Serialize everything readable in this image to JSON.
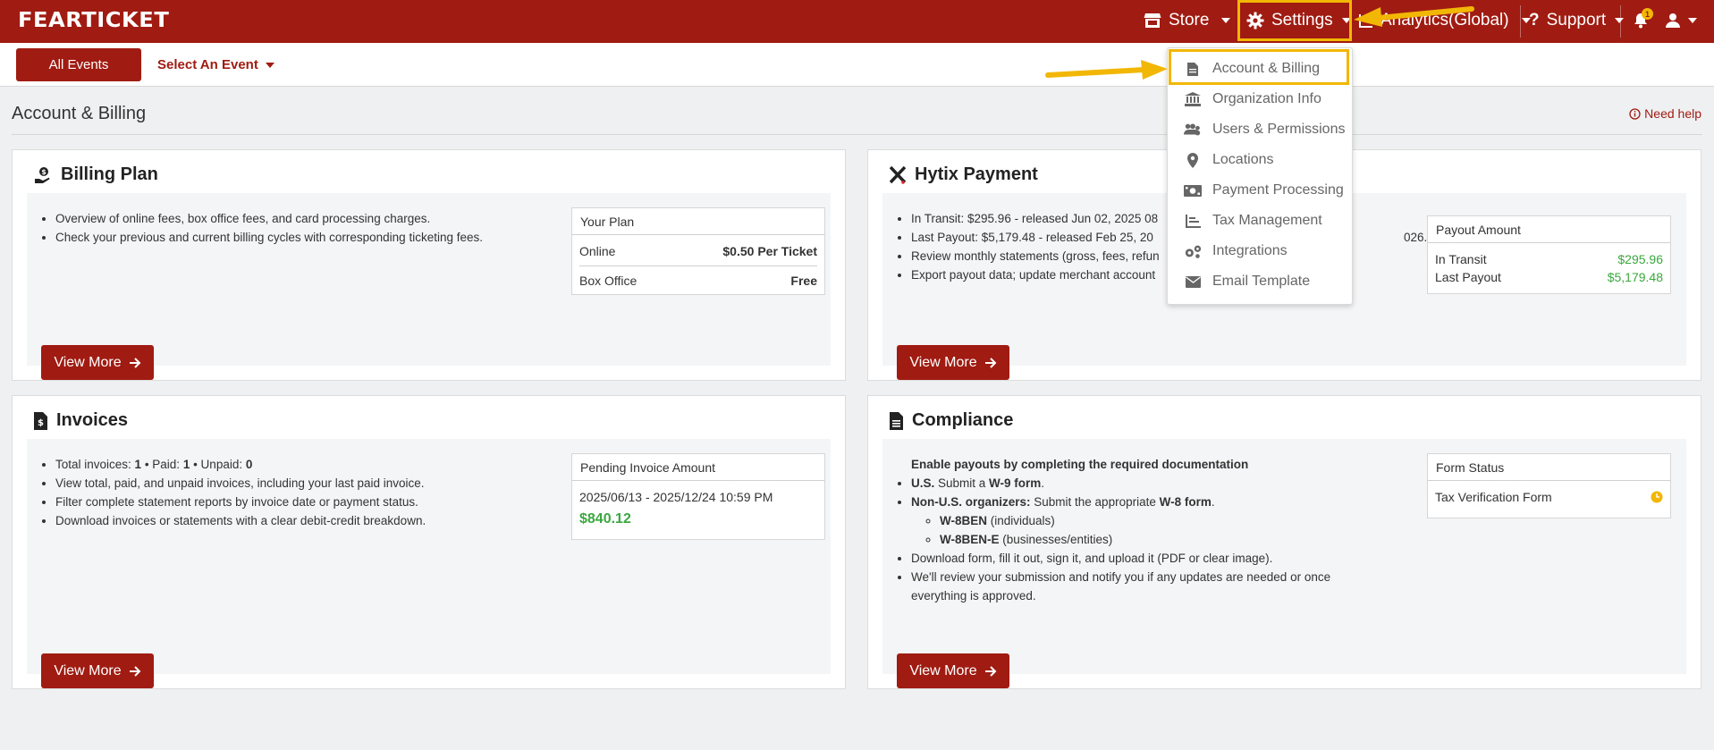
{
  "brand": {
    "logo": "FEARTICKET"
  },
  "topnav": {
    "store": "Store",
    "settings": "Settings",
    "analytics": "Analytics(Global)",
    "support": "Support",
    "notif_count": "1"
  },
  "subnav": {
    "all_events": "All Events",
    "select_event": "Select An Event"
  },
  "page": {
    "title": "Account & Billing",
    "help": "Need help"
  },
  "settings_menu": {
    "items": [
      {
        "label": "Account & Billing",
        "icon": "file-icon"
      },
      {
        "label": "Organization Info",
        "icon": "bank-icon"
      },
      {
        "label": "Users & Permissions",
        "icon": "users-icon"
      },
      {
        "label": "Locations",
        "icon": "map-pin-icon"
      },
      {
        "label": "Payment Processing",
        "icon": "money-icon"
      },
      {
        "label": "Tax Management",
        "icon": "chart-icon"
      },
      {
        "label": "Integrations",
        "icon": "cogs-icon"
      },
      {
        "label": "Email Template",
        "icon": "envelope-icon"
      }
    ]
  },
  "billing": {
    "title": "Billing Plan",
    "bullets": [
      "Overview of online fees, box office fees, and card processing charges.",
      "Check your previous and current billing cycles with corresponding ticketing fees."
    ],
    "box_title": "Your Plan",
    "online_label": "Online",
    "online_value": "$0.50 Per Ticket",
    "box_office_label": "Box Office",
    "box_office_value": "Free",
    "view_more": "View More"
  },
  "hytix": {
    "title": "Hytix Payment",
    "bullets": [
      "In Transit: $295.96 - released Jun 02, 2025 08",
      "Last Payout: $5,179.48 - released Feb 25, 20",
      "Review monthly statements (gross, fees, refun",
      "Export payout data; update merchant account"
    ],
    "bullet_tail": "026.",
    "box_title": "Payout Amount",
    "in_transit_label": "In Transit",
    "in_transit_value": "$295.96",
    "last_payout_label": "Last Payout",
    "last_payout_value": "$5,179.48",
    "view_more": "View More"
  },
  "invoices": {
    "title": "Invoices",
    "b1_a": "Total invoices: ",
    "b1_total": "1",
    "b1_b": " • Paid: ",
    "b1_paid": "1",
    "b1_c": " • Unpaid: ",
    "b1_unpaid": "0",
    "bullets": [
      "View total, paid, and unpaid invoices, including your last paid invoice.",
      "Filter complete statement reports by invoice date or payment status.",
      "Download invoices or statements with a clear debit-credit breakdown."
    ],
    "box_title": "Pending Invoice Amount",
    "date_range": "2025/06/13 - 2025/12/24 10:59 PM",
    "amount": "$840.12",
    "view_more": "View More"
  },
  "compliance": {
    "title": "Compliance",
    "heading": "Enable payouts by completing the required documentation",
    "us_label": "U.S.",
    "us_text_a": " Submit a ",
    "us_form": "W-9 form",
    "us_text_b": ".",
    "nonus_label": "Non-U.S. organizers:",
    "nonus_text_a": " Submit the appropriate ",
    "nonus_form": "W-8 form",
    "nonus_text_b": ".",
    "w8ben": "W-8BEN",
    "w8ben_desc": " (individuals)",
    "w8bene": "W-8BEN-E",
    "w8bene_desc": " (businesses/entities)",
    "b3": "Download form, fill it out, sign it, and upload it (PDF or clear image).",
    "b4": "We'll review your submission and notify you if any updates are needed or once everything is approved.",
    "box_title": "Form Status",
    "form_label": "Tax Verification Form",
    "view_more": "View More"
  },
  "colors": {
    "brand": "#a01c12",
    "highlight": "#f2b705",
    "money": "#3aa83e"
  }
}
